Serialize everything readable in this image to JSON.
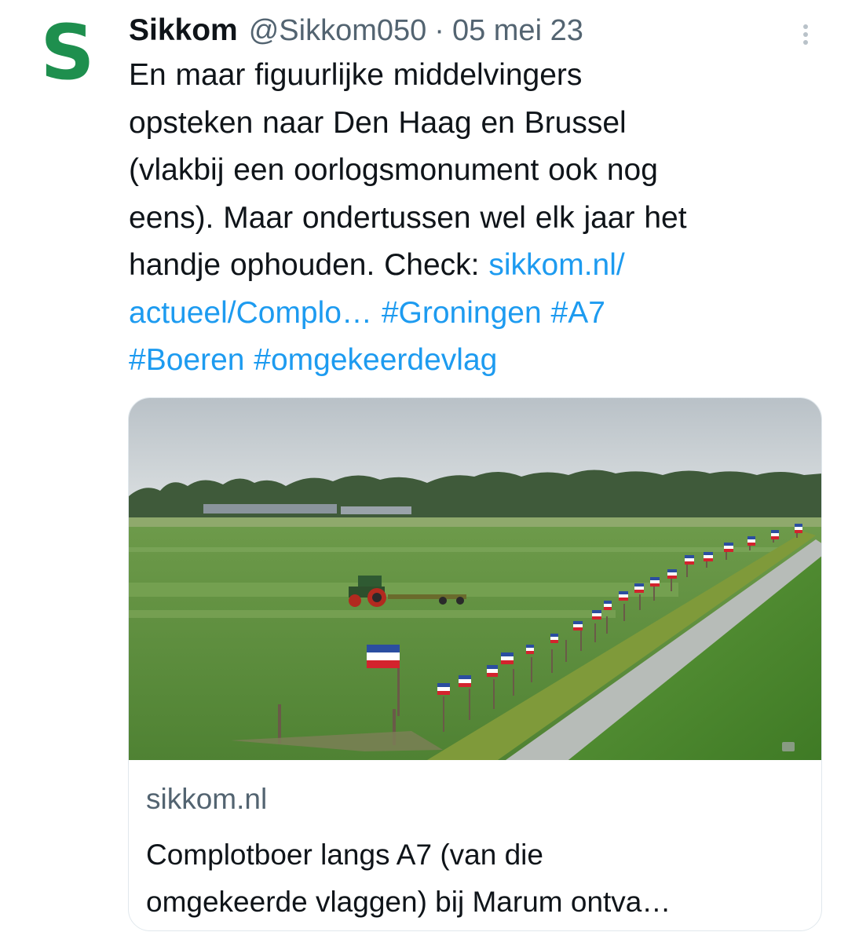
{
  "tweet": {
    "avatar_letter": "S",
    "avatar_color": "#1e8f4e",
    "display_name": "Sikkom",
    "handle": "@Sikkom050",
    "separator": "·",
    "timestamp": "05 mei 23",
    "more_icon": "more-vertical-icon",
    "text_line_1": "En maar figuurlijke middelvingers",
    "text_line_2": "opsteken naar Den Haag en Brussel",
    "text_line_3": "(vlakbij een oorlogsmonument ook nog",
    "text_line_4": "eens). Maar ondertussen wel elk jaar het",
    "text_line_5_plain": "handje ophouden. Check: ",
    "link_part_1": "sikkom.nl/",
    "link_part_2": "actueel/Complo…",
    "hashtags": [
      "#Groningen",
      "#A7",
      "#Boeren",
      "#omgekeerdevlag"
    ],
    "link_color": "#1d9bf0"
  },
  "card": {
    "domain": "sikkom.nl",
    "title_line_1": "Complotboer langs A7 (van die",
    "title_line_2": "omgekeerde vlaggen) bij Marum ontva…"
  }
}
